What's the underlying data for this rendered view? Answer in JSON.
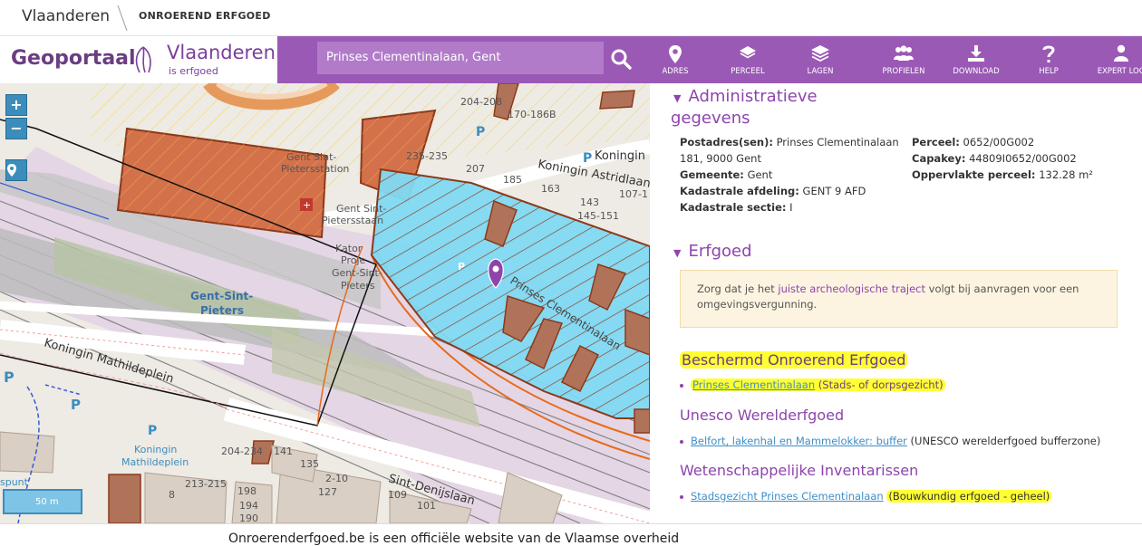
{
  "topbar": {
    "brand": "Vlaanderen",
    "section": "ONROEREND ERFGOED"
  },
  "header": {
    "logo_geoportaal": "Geoportaal",
    "logo_vlaanderen": "Vlaanderen",
    "logo_sub": "is erfgoed",
    "search_value": "Prinses Clementinalaan, Gent",
    "nav": [
      {
        "label": "ADRES",
        "icon": "map-pin-icon"
      },
      {
        "label": "PERCEEL",
        "icon": "layers-diamond-icon"
      },
      {
        "label": "LAGEN",
        "icon": "layers-stack-icon"
      },
      {
        "label": "PROFIELEN",
        "icon": "users-icon"
      },
      {
        "label": "DOWNLOAD",
        "icon": "download-icon"
      },
      {
        "label": "HELP",
        "icon": "help-icon"
      },
      {
        "label": "EXPERT LOG",
        "icon": "user-icon"
      }
    ]
  },
  "map": {
    "controls": {
      "zoom_in": "+",
      "zoom_out": "−"
    },
    "scale": "50 m",
    "labels": {
      "station1": "Gent Sint-",
      "station2": "Pietersstation",
      "station3": "Gent Sint-",
      "station4": "Pietersstaan",
      "gsp1": "Gent-Sint-",
      "gsp2": "Pieters",
      "koningin_astrid": "Koningin Astridlaan",
      "koningin_top": "Koningin",
      "mathilde_street": "Koningin Mathildeplein",
      "mathilde_p1": "Koningin",
      "mathilde_p2": "Mathildeplein",
      "denijs": "Sint-Denijslaan",
      "prinses": "Prinses Clementinalaan",
      "proj1": "Kator",
      "proj2": "Proje",
      "proj3": "Gent-Sint-",
      "proj4": "Pieters",
      "n_204_208": "204-208",
      "n_170": "170-186B",
      "n_233": "235-235",
      "n_207": "207",
      "n_185": "185",
      "n_163": "163",
      "n_143": "143",
      "n_107": "107-1",
      "n_145": "145-151",
      "n_204_234": "204-234",
      "n_141": "141",
      "n_135": "135",
      "n_2_10": "2-10",
      "n_127": "127",
      "n_198": "198",
      "n_194": "194",
      "n_190": "190",
      "n_109": "109",
      "n_101": "101",
      "n_213": "213-215",
      "n_8": "8",
      "spunt": "spunt"
    }
  },
  "panel": {
    "admin_title_1": "Administratieve",
    "admin_title_2": "gegevens",
    "postadres_label": "Postadres(sen):",
    "postadres_value_1": "Prinses Clementinalaan",
    "postadres_value_2": "181, 9000 Gent",
    "gemeente_label": "Gemeente:",
    "gemeente_value": "Gent",
    "afdeling_label": "Kadastrale afdeling:",
    "afdeling_value": "GENT 9 AFD",
    "sectie_label": "Kadastrale sectie:",
    "sectie_value": "I",
    "perceel_label": "Perceel:",
    "perceel_value": "0652/00G002",
    "capakey_label": "Capakey:",
    "capakey_value": "44809I0652/00G002",
    "opp_label": "Oppervlakte perceel:",
    "opp_value": "132.28 m²",
    "erfgoed_title": "Erfgoed",
    "notice_pre": "Zorg dat je het",
    "notice_link": "juiste archeologische traject",
    "notice_post": "volgt bij aanvragen voor een omgevingsvergunning.",
    "beschermd_title": "Beschermd Onroerend Erfgoed",
    "beschermd_link": "Prinses Clementinalaan",
    "beschermd_type": "(Stads- of dorpsgezicht)",
    "unesco_title": "Unesco Werelderfgoed",
    "unesco_link": "Belfort, lakenhal en Mammelokker: buffer",
    "unesco_type": "(UNESCO werelderfgoed bufferzone)",
    "wet_title": "Wetenschappelijke Inventarissen",
    "wet_link": "Stadsgezicht Prinses Clementinalaan",
    "wet_type": "(Bouwkundig erfgoed - geheel)"
  },
  "footer": {
    "text": "Onroerenderfgoed.be is een officiële website van de Vlaamse overheid"
  }
}
